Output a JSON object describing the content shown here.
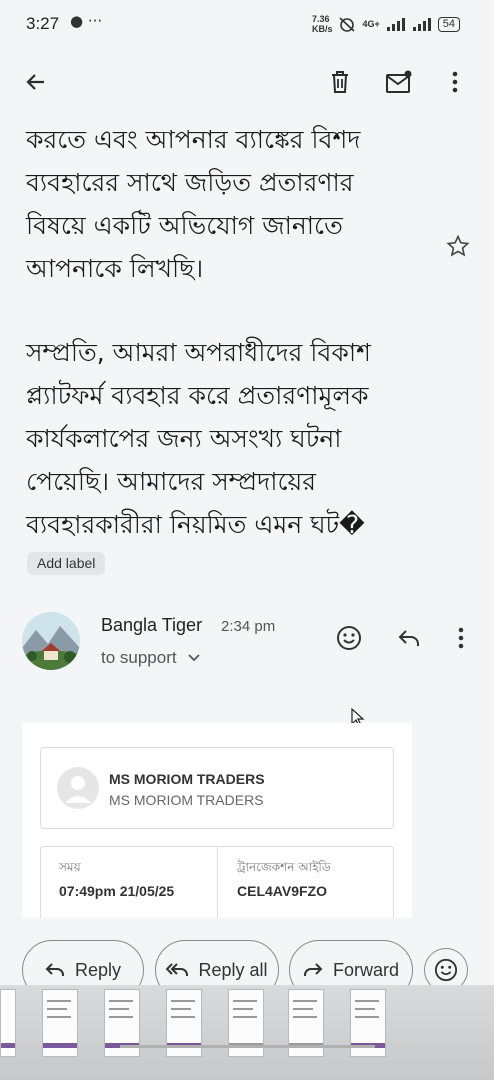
{
  "status_bar": {
    "time": "3:27",
    "left_icons": "chat-bubble-icon more-dots-icon",
    "notif_glyphs": "● ···",
    "speed": "7.36",
    "speed_unit": "KB/s",
    "network": "4G+",
    "battery": "54"
  },
  "toolbar": {
    "back": "arrow-left-icon",
    "delete": "trash-icon",
    "mark_unread": "mail-badge-icon",
    "more": "more-vert-icon"
  },
  "email": {
    "paragraph1": [
      "করতে এবং আপনার ব্যাঙ্কের বিশদ",
      "ব্যবহারের সাথে জড়িত প্রতারণার",
      "বিষয়ে একটি অভিযোগ জানাতে",
      "আপনাকে লিখছি।"
    ],
    "paragraph2": [
      "সম্প্রতি, আমরা অপরাধীদের বিকাশ",
      "প্ল্যাটফর্ম ব্যবহার করে প্রতারণামূলক",
      "কার্যকলাপের জন্য অসংখ্য ঘটনা",
      "পেয়েছি। আমাদের সম্প্রদায়ের",
      "ব্যবহারকারীরা নিয়মিত এমন ঘট�"
    ],
    "add_label": "Add label"
  },
  "message": {
    "sender": "Bangla Tiger",
    "time": "2:34 pm",
    "recipient": "to support"
  },
  "receipt": {
    "merchant_title": "MS MORIOM TRADERS",
    "merchant_subtitle": "MS MORIOM TRADERS",
    "time_label": "সময়",
    "time_value": "07:49pm 21/05/25",
    "txn_label": "ট্রানজেকশন আইডি",
    "txn_value": "CEL4AV9FZO"
  },
  "actions": {
    "reply": "Reply",
    "reply_all": "Reply all",
    "forward": "Forward"
  },
  "colors": {
    "background": "#f3f5f7",
    "text": "#1a1a1a",
    "chip": "#e3e6e9",
    "accent_purple": "#7a5a9a"
  }
}
